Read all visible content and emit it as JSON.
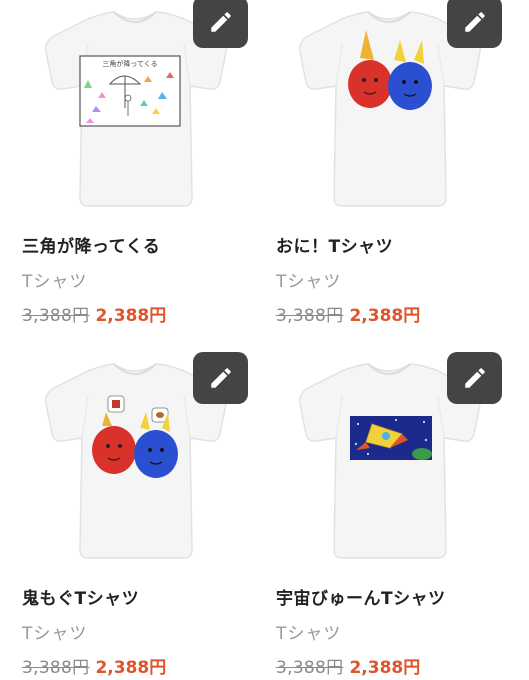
{
  "products": [
    {
      "title": "三角が降ってくる",
      "category": "Tシャツ",
      "price_original": "3,388円",
      "price_sale": "2,388円",
      "print_text": "三角が降ってくる"
    },
    {
      "title": "おに！Tシャツ",
      "category": "Tシャツ",
      "price_original": "3,388円",
      "price_sale": "2,388円"
    },
    {
      "title": "鬼もぐTシャツ",
      "category": "Tシャツ",
      "price_original": "3,388円",
      "price_sale": "2,388円"
    },
    {
      "title": "宇宙びゅーんTシャツ",
      "category": "Tシャツ",
      "price_original": "3,388円",
      "price_sale": "2,388円"
    }
  ],
  "icons": {
    "edit": "pencil-icon"
  },
  "colors": {
    "sale": "#e0542c",
    "edit_button": "#444444",
    "title": "#222222",
    "category": "#9a9a9a"
  }
}
